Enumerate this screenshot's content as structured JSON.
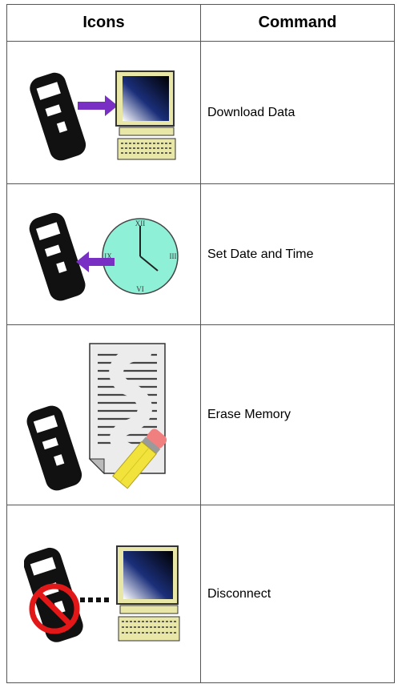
{
  "table": {
    "headers": {
      "icons": "Icons",
      "command": "Command"
    },
    "rows": [
      {
        "icon": "download-data-icon",
        "command": "Download Data"
      },
      {
        "icon": "set-date-time-icon",
        "command": "Set Date and Time"
      },
      {
        "icon": "erase-memory-icon",
        "command": "Erase Memory"
      },
      {
        "icon": "disconnect-icon",
        "command": "Disconnect"
      }
    ],
    "clock_numerals": {
      "twelve": "XII",
      "three": "III",
      "six": "VI",
      "nine": "IX"
    }
  }
}
